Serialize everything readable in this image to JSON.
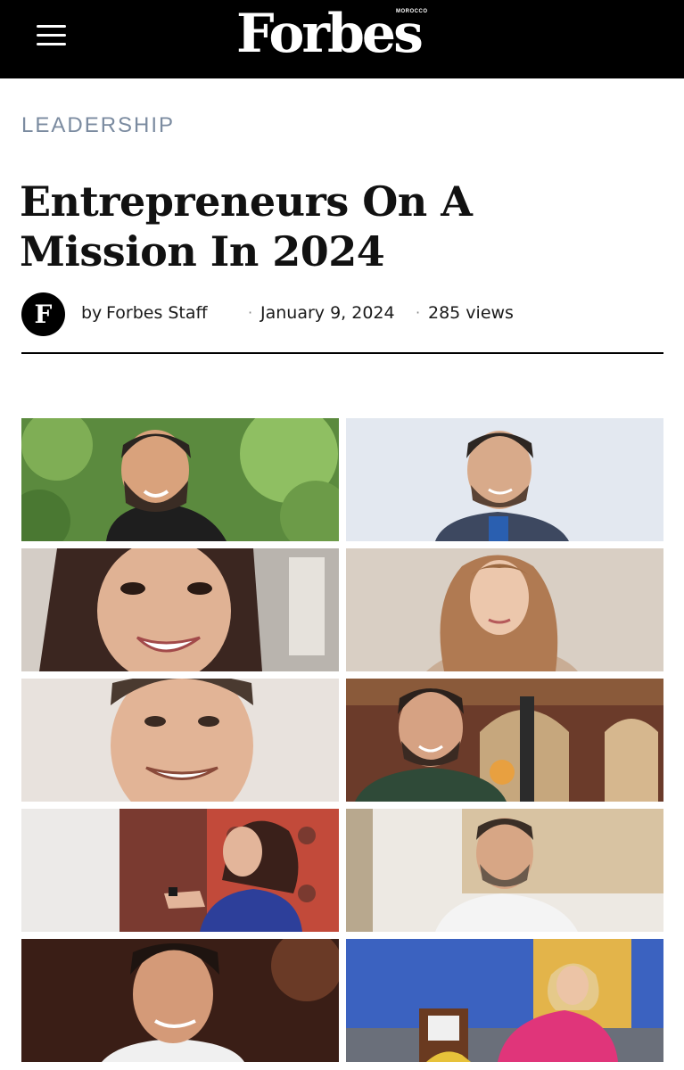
{
  "header": {
    "logo_text": "Forbes",
    "logo_edition": "MOROCCO",
    "menu_icon": "hamburger-menu-icon"
  },
  "article": {
    "section": "LEADERSHIP",
    "title": "Entrepreneurs On A Mission In 2024",
    "author_avatar_letter": "F",
    "by_prefix": "by",
    "author": "Forbes Staff",
    "separator": "·",
    "date": "January 9, 2024",
    "views": "285 views"
  },
  "photos": [
    {
      "name": "photo-man-beard-garden"
    },
    {
      "name": "photo-man-blue-jacket"
    },
    {
      "name": "photo-woman-smiling-dark-hair"
    },
    {
      "name": "photo-woman-long-hair"
    },
    {
      "name": "photo-man-closeup-smiling"
    },
    {
      "name": "photo-man-green-shirt-restaurant"
    },
    {
      "name": "photo-woman-speaker-stage"
    },
    {
      "name": "photo-man-white-shirt-office"
    },
    {
      "name": "photo-man-dark-background"
    },
    {
      "name": "photo-woman-pink-suit-chair"
    }
  ],
  "colors": {
    "topbar": "#000000",
    "section_label": "#7b8ba0",
    "headline": "#111111",
    "divider": "#000000"
  }
}
